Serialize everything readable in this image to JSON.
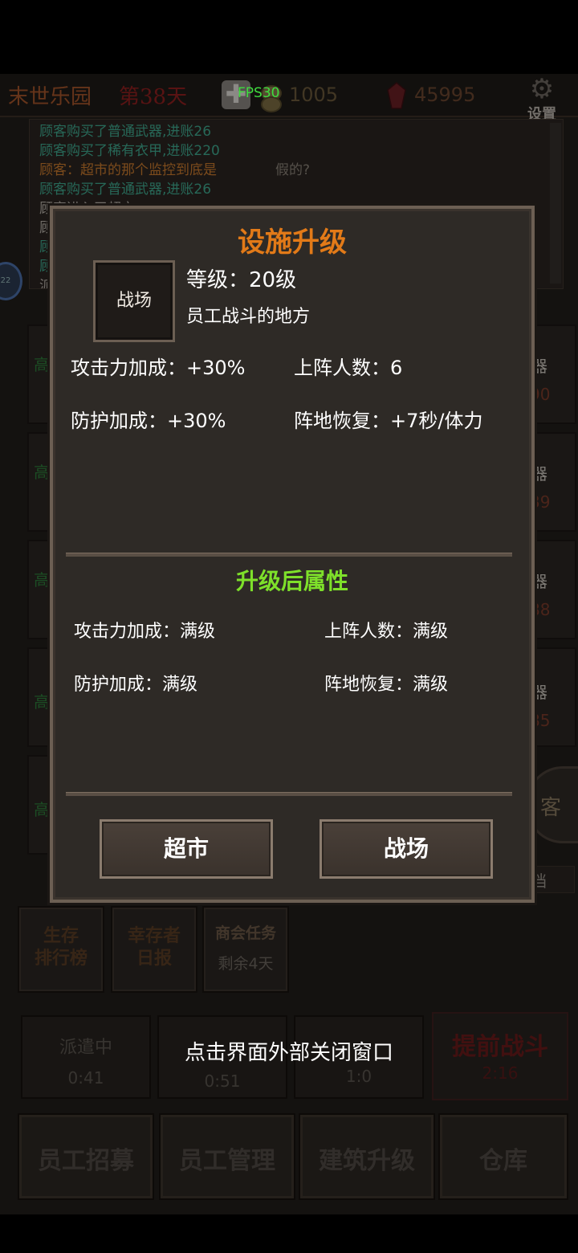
{
  "topbar": {
    "park_name": "末世乐园",
    "day": "第38天",
    "plus": "✚",
    "coins": "1005",
    "gems": "45995",
    "settings_label": "设置"
  },
  "log": [
    {
      "text": "顾客购买了普通武器,进账26",
      "color": "#3fa88e"
    },
    {
      "text": "顾客购买了稀有衣甲,进账220",
      "color": "#3fa88e"
    },
    {
      "text": "顾客：超市的那个监控到底是",
      "color": "#c97a2e"
    },
    {
      "text": "顾客购买了普通武器,进账26",
      "color": "#3fa88e"
    },
    {
      "text": "顾客进入了超市",
      "color": "#b8b2aa"
    },
    {
      "text": "顾",
      "color": "#b8b2aa"
    },
    {
      "text": "顾",
      "color": "#3fa88e"
    },
    {
      "text": "顾",
      "color": "#3fa88e"
    },
    {
      "text": "派",
      "color": "#b8b2aa"
    }
  ],
  "log_tail": "假的?",
  "fps": "FPS30",
  "side_bubble": "22",
  "background": {
    "left_cards": [
      "高",
      "高",
      "高",
      "高",
      "高"
    ],
    "right_top": [
      "器",
      "器",
      "器",
      "器"
    ],
    "right_bottom": [
      "90",
      "39",
      "88",
      "85"
    ],
    "customer_btn": "客",
    "archive": "档"
  },
  "panels": [
    {
      "line1": "生存",
      "line2": "排行榜"
    },
    {
      "line1": "幸存者",
      "line2": "日报"
    },
    {
      "line1": "商会任务",
      "line2": "剩余4天"
    }
  ],
  "dispatch": [
    {
      "label": "派遣中",
      "time": "0:41"
    },
    {
      "label": "",
      "time": "0:51"
    },
    {
      "label": "",
      "time": "1:0"
    }
  ],
  "early_battle": {
    "label": "提前战斗",
    "time": "2:16"
  },
  "bottom_nav": [
    "员工招募",
    "员工管理",
    "建筑升级",
    "仓库"
  ],
  "dialog": {
    "title": "设施升级",
    "facility_name": "战场",
    "level": "等级：20级",
    "desc": "员工战斗的地方",
    "current": {
      "attack": "攻击力加成：+30%",
      "defense": "防护加成：+30%",
      "slots": "上阵人数：6",
      "recovery": "阵地恢复：+7秒/体力"
    },
    "after_title": "升级后属性",
    "after": {
      "attack": "攻击力加成：满级",
      "defense": "防护加成：满级",
      "slots": "上阵人数：满级",
      "recovery": "阵地恢复：满级"
    },
    "btn_left": "超市",
    "btn_right": "战场"
  },
  "close_hint": "点击界面外部关闭窗口"
}
